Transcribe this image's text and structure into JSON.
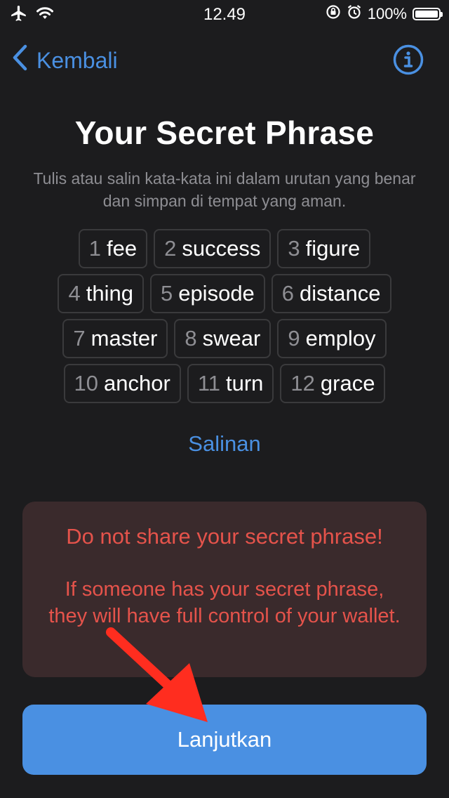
{
  "status_bar": {
    "time": "12.49",
    "battery": "100%"
  },
  "nav": {
    "back_label": "Kembali"
  },
  "header": {
    "title": "Your Secret Phrase",
    "subtitle": "Tulis atau salin kata-kata ini dalam urutan yang benar dan simpan di tempat yang aman."
  },
  "phrase": {
    "rows": [
      [
        {
          "num": "1",
          "word": "fee"
        },
        {
          "num": "2",
          "word": "success"
        },
        {
          "num": "3",
          "word": "figure"
        }
      ],
      [
        {
          "num": "4",
          "word": "thing"
        },
        {
          "num": "5",
          "word": "episode"
        },
        {
          "num": "6",
          "word": "distance"
        }
      ],
      [
        {
          "num": "7",
          "word": "master"
        },
        {
          "num": "8",
          "word": "swear"
        },
        {
          "num": "9",
          "word": "employ"
        }
      ],
      [
        {
          "num": "10",
          "word": "anchor"
        },
        {
          "num": "11",
          "word": "turn"
        },
        {
          "num": "12",
          "word": "grace"
        }
      ]
    ]
  },
  "copy": {
    "label": "Salinan"
  },
  "warning": {
    "title": "Do not share your secret phrase!",
    "body": "If someone has your secret phrase, they will have full control of your wallet."
  },
  "continue": {
    "label": "Lanjutkan"
  },
  "colors": {
    "background": "#1c1c1e",
    "accent": "#4a90e2",
    "warning_text": "#e5534b",
    "warning_bg": "#3a2a2c",
    "annotation_arrow": "#ff2d1f"
  }
}
